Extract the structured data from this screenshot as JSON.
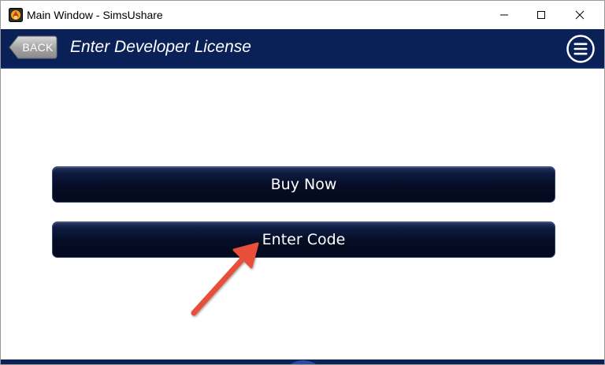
{
  "window": {
    "title": "Main Window - SimsUshare",
    "controls": {
      "minimize_icon": "minimize-icon",
      "maximize_icon": "maximize-icon",
      "close_icon": "close-icon"
    }
  },
  "header": {
    "back_label": "BACK",
    "title": "Enter Developer License",
    "menu_icon": "hamburger-menu-icon",
    "background_color": "#0a2158"
  },
  "main": {
    "buttons": [
      {
        "label": "Buy Now"
      },
      {
        "label": "Enter Code"
      }
    ],
    "annotation": {
      "icon": "red-arrow-icon",
      "color": "#e8503a"
    }
  }
}
